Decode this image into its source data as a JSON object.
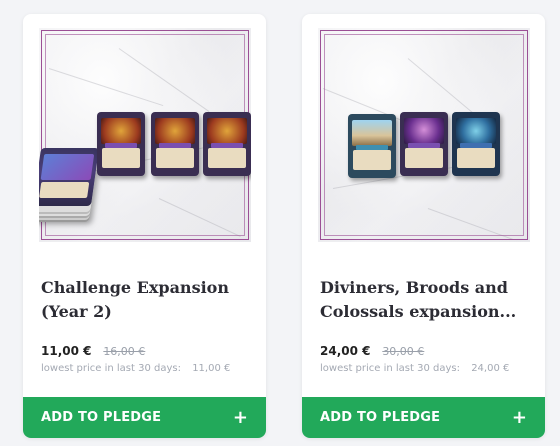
{
  "products": [
    {
      "title": "Challenge Expansion (Year 2)",
      "price": "11,00 €",
      "old_price": "16,00 €",
      "lowest_label": "lowest price in last 30 days:",
      "lowest_value": "11,00 €",
      "button_label": "ADD TO PLEDGE",
      "button_icon": "+"
    },
    {
      "title": "Diviners, Broods and Colossals expansion...",
      "price": "24,00 €",
      "old_price": "30,00 €",
      "lowest_label": "lowest price in last 30 days:",
      "lowest_value": "24,00 €",
      "button_label": "ADD TO PLEDGE",
      "button_icon": "+"
    }
  ],
  "colors": {
    "button": "#22a95a",
    "frame": "#9b4f95",
    "background": "#f3f4f7"
  }
}
